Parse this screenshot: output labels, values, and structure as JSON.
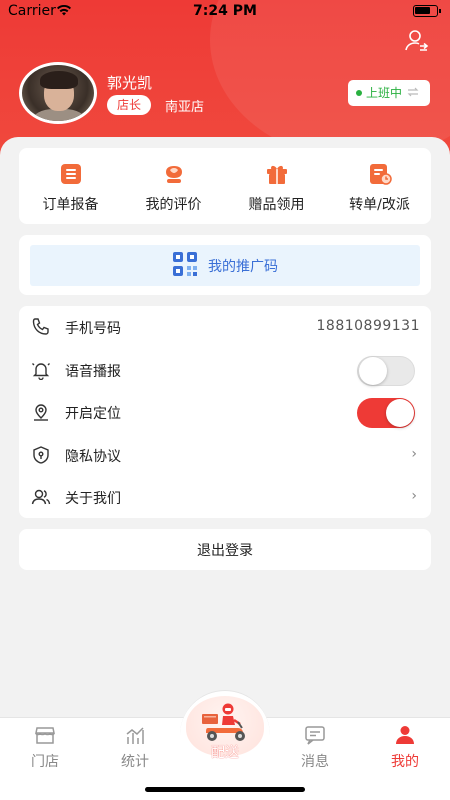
{
  "status_bar": {
    "carrier": "Carrier",
    "time": "7:24 PM"
  },
  "profile": {
    "name": "郭光凯",
    "role": "店长",
    "store": "南亚店",
    "work_status": "上班中"
  },
  "quick_actions": [
    {
      "label": "订单报备",
      "icon": "order-report-icon"
    },
    {
      "label": "我的评价",
      "icon": "review-icon"
    },
    {
      "label": "赠品领用",
      "icon": "gift-icon"
    },
    {
      "label": "转单/改派",
      "icon": "transfer-icon"
    }
  ],
  "promo": {
    "label": "我的推广码",
    "icon": "qr-code-icon"
  },
  "settings": {
    "phone": {
      "label": "手机号码",
      "value": "18810899131"
    },
    "voice": {
      "label": "语音播报",
      "enabled": false
    },
    "location": {
      "label": "开启定位",
      "enabled": true
    },
    "privacy": {
      "label": "隐私协议"
    },
    "about": {
      "label": "关于我们"
    }
  },
  "logout": {
    "label": "退出登录"
  },
  "tabbar": {
    "items": [
      {
        "label": "门店",
        "icon": "store-icon"
      },
      {
        "label": "统计",
        "icon": "stats-icon"
      },
      {
        "label": "配送",
        "icon": "delivery-rider-icon"
      },
      {
        "label": "消息",
        "icon": "message-icon"
      },
      {
        "label": "我的",
        "icon": "profile-icon"
      }
    ],
    "active_index": 4
  },
  "colors": {
    "brand_red": "#ee3a36",
    "online_green": "#29b03f",
    "promo_blue": "#3a6fd6",
    "quick_orange": "#f26b3a"
  },
  "chevron": "›"
}
